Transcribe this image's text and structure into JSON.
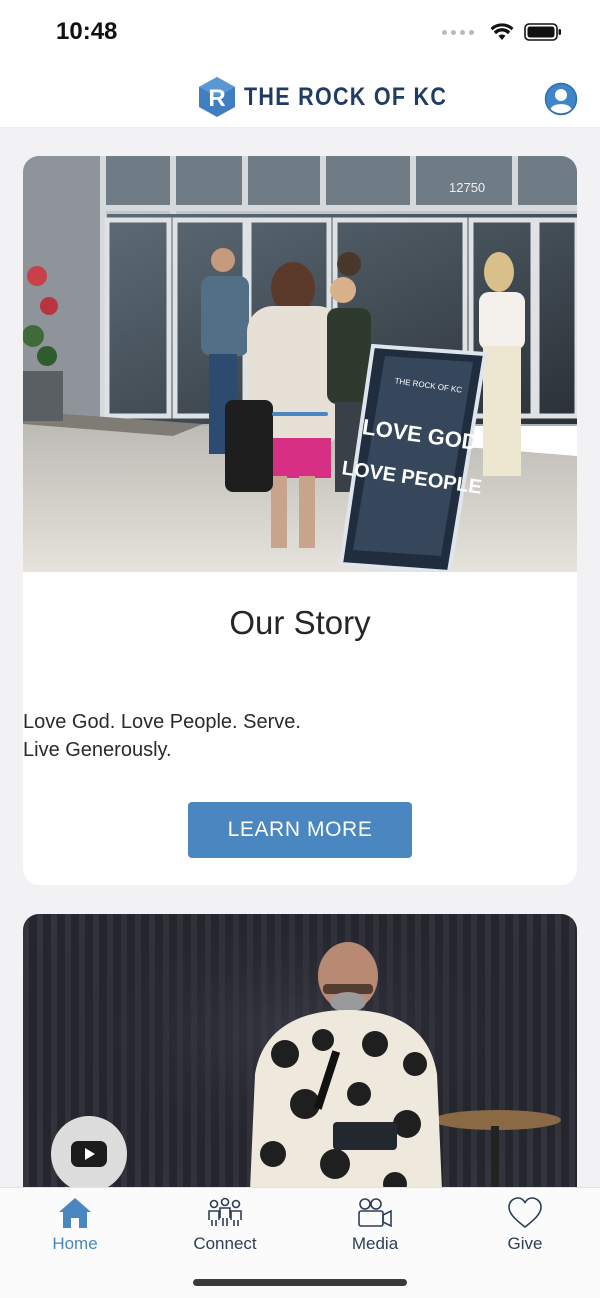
{
  "status_bar": {
    "time": "10:48"
  },
  "header": {
    "logo_letter": "R",
    "logo_text": "THE ROCK OF KC",
    "profile_icon": "person-circle-icon",
    "brand_color": "#1f3d63",
    "accent_color": "#4a86c0"
  },
  "story_card": {
    "photo_sign_top": "THE ROCK OF KC",
    "photo_sign_line1": "LOVE GOD",
    "photo_sign_line2": "LOVE PEOPLE",
    "photo_address": "12750",
    "title": "Our Story",
    "text_line1": "Love God. Love People. Serve.",
    "text_line2": "Live Generously.",
    "button_label": "LEARN MORE"
  },
  "video_card": {
    "play_icon": "youtube-play-icon"
  },
  "tabs": [
    {
      "label": "Home",
      "icon": "home-icon",
      "active": true
    },
    {
      "label": "Connect",
      "icon": "people-icon",
      "active": false
    },
    {
      "label": "Media",
      "icon": "video-camera-icon",
      "active": false
    },
    {
      "label": "Give",
      "icon": "heart-icon",
      "active": false
    }
  ]
}
